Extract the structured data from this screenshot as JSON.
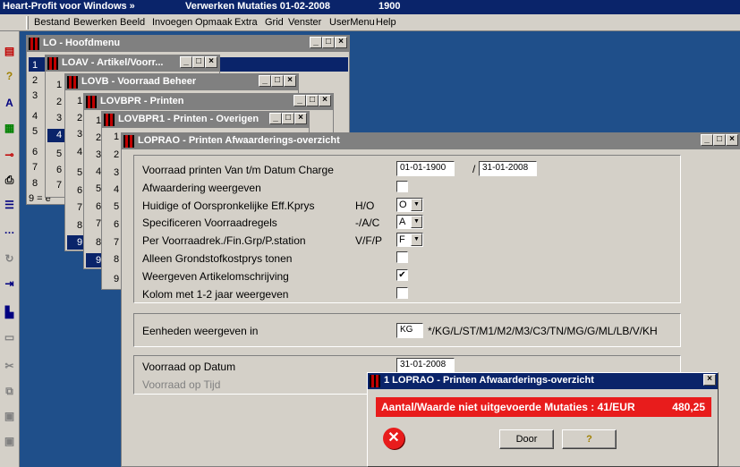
{
  "app": {
    "title": "Heart-Profit voor Windows »",
    "status": "Verwerken Mutaties 01-02-2008",
    "code": "1900"
  },
  "menu": [
    "Bestand",
    "Bewerken",
    "Beeld",
    "Invoegen",
    "Opmaak",
    "Extra",
    "Grid",
    "Venster",
    "UserMenu",
    "Help"
  ],
  "toolbar_icons": [
    "report-icon",
    "question-icon",
    "font-icon",
    "calculator-icon",
    "key-icon",
    "print-icon",
    "list-icon",
    "dots-icon",
    "refresh-icon",
    "export-icon",
    "chart-icon",
    "window-icon",
    "cut-icon",
    "copy-icon",
    "paste-icon",
    "paste-special-icon"
  ],
  "windows": {
    "w1": {
      "title": "LO - Hoofdmenu",
      "nums": [
        "1",
        "2",
        "3",
        "4",
        "5",
        "6",
        "7",
        "8",
        "9 = e"
      ]
    },
    "w2": {
      "title": "LOAV - Artikel/Voorr...",
      "nums": [
        "1",
        "2",
        "3",
        "4",
        "5",
        "6",
        "7"
      ]
    },
    "w3": {
      "title": "LOVB - Voorraad Beheer",
      "nums": [
        "1",
        "2",
        "3",
        "4",
        "5",
        "6",
        "7",
        "8",
        "9"
      ]
    },
    "w4": {
      "title": "LOVBPR - Printen",
      "nums": [
        "1",
        "2",
        "3",
        "4",
        "5",
        "6",
        "7",
        "8",
        "9"
      ]
    },
    "w5": {
      "title": "LOVBPR1 - Printen - Overigen",
      "nums": [
        "1",
        "2",
        "3",
        "4",
        "5",
        "6",
        "7",
        "8",
        "9"
      ]
    }
  },
  "form": {
    "title": "LOPRAO - Printen Afwaarderings-overzicht",
    "rows": [
      {
        "label": "Voorraad printen Van t/m Datum Charge",
        "from": "01-01-1900",
        "sep": "/",
        "to": "31-01-2008"
      },
      {
        "label": "Afwaardering weergeven",
        "checked": ""
      },
      {
        "label": "Huidige of Oorspronkelijke Eff.Kprys",
        "code": "H/O",
        "value": "O"
      },
      {
        "label": "Specificeren Voorraadregels",
        "code": "-/A/C",
        "value": "A"
      },
      {
        "label": "Per Voorraadrek./Fin.Grp/P.station",
        "code": "V/F/P",
        "value": "F"
      },
      {
        "label": "Alleen Grondstofkostprys tonen",
        "checked": ""
      },
      {
        "label": "Weergeven Artikelomschrijving",
        "checked": "✔"
      },
      {
        "label": "Kolom met 1-2 jaar weergeven",
        "checked": ""
      }
    ],
    "units": {
      "label": "Eenheden weergeven in",
      "value": "KG",
      "options": "*/KG/L/ST/M1/M2/M3/C3/TN/MG/G/ML/LB/V/KH"
    },
    "date": {
      "label": "Voorraad op Datum",
      "value": "31-01-2008"
    },
    "time": {
      "label": "Voorraad op Tijd"
    }
  },
  "dialog": {
    "title": "1 LOPRAO - Printen Afwaarderings-overzicht",
    "message": "Aantal/Waarde niet uitgevoerde Mutaties : 41/EUR",
    "amount": "480,25",
    "door_button": "Door",
    "help_button": "?",
    "colors": {
      "banner": "#e81c1c",
      "error_icon": "#e81c1c"
    }
  }
}
